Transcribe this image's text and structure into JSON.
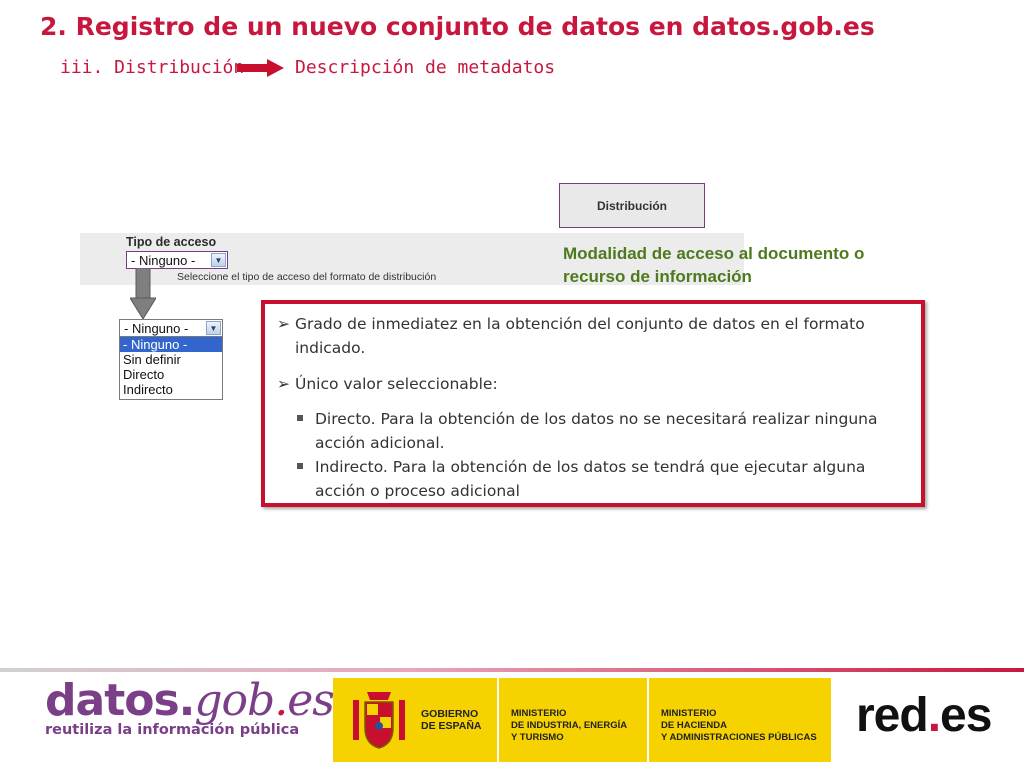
{
  "header": {
    "title": "2. Registro de un nuevo conjunto de datos en datos.gob.es",
    "subtitle_left": "iii. Distribución",
    "subtitle_right": "Descripción de metadatos",
    "accent_color": "#c8173f"
  },
  "section_box": {
    "label": "Distribución"
  },
  "form": {
    "label": "Tipo de acceso",
    "select_value": "- Ninguno -",
    "help_text": "Seleccione el tipo de acceso del formato de distribución"
  },
  "callout": {
    "text_line1": "Modalidad de acceso al documento o",
    "text_line2": "recurso de información",
    "color": "#4e7a1e"
  },
  "dropdown_open": {
    "value": "- Ninguno -",
    "options": [
      "- Ninguno -",
      "Sin definir",
      "Directo",
      "Indirecto"
    ],
    "selected_index": 0
  },
  "info": {
    "bullet1": "Grado de inmediatez en la obtención del conjunto de datos en el formato indicado.",
    "bullet2": "Único valor seleccionable:",
    "sub1": "Directo. Para la obtención de los datos no se necesitará realizar ninguna acción adicional.",
    "sub2": "Indirecto. Para la obtención de los datos se tendrá que ejecutar alguna acción o proceso adicional"
  },
  "footer": {
    "logo_part1": "datos.",
    "logo_part2": "gob",
    "logo_part3": ".",
    "logo_part4": "es",
    "tagline": "reutiliza la información pública",
    "gov_line1": "GOBIERNO",
    "gov_line2": "DE ESPAÑA",
    "min1_line1": "MINISTERIO",
    "min1_line2": "DE INDUSTRIA, ENERGÍA",
    "min1_line3": "Y TURISMO",
    "min2_line1": "MINISTERIO",
    "min2_line2": "DE HACIENDA",
    "min2_line3": "Y ADMINISTRACIONES PÚBLICAS",
    "redes_part1": "red",
    "redes_part2": ".",
    "redes_part3": "es"
  }
}
